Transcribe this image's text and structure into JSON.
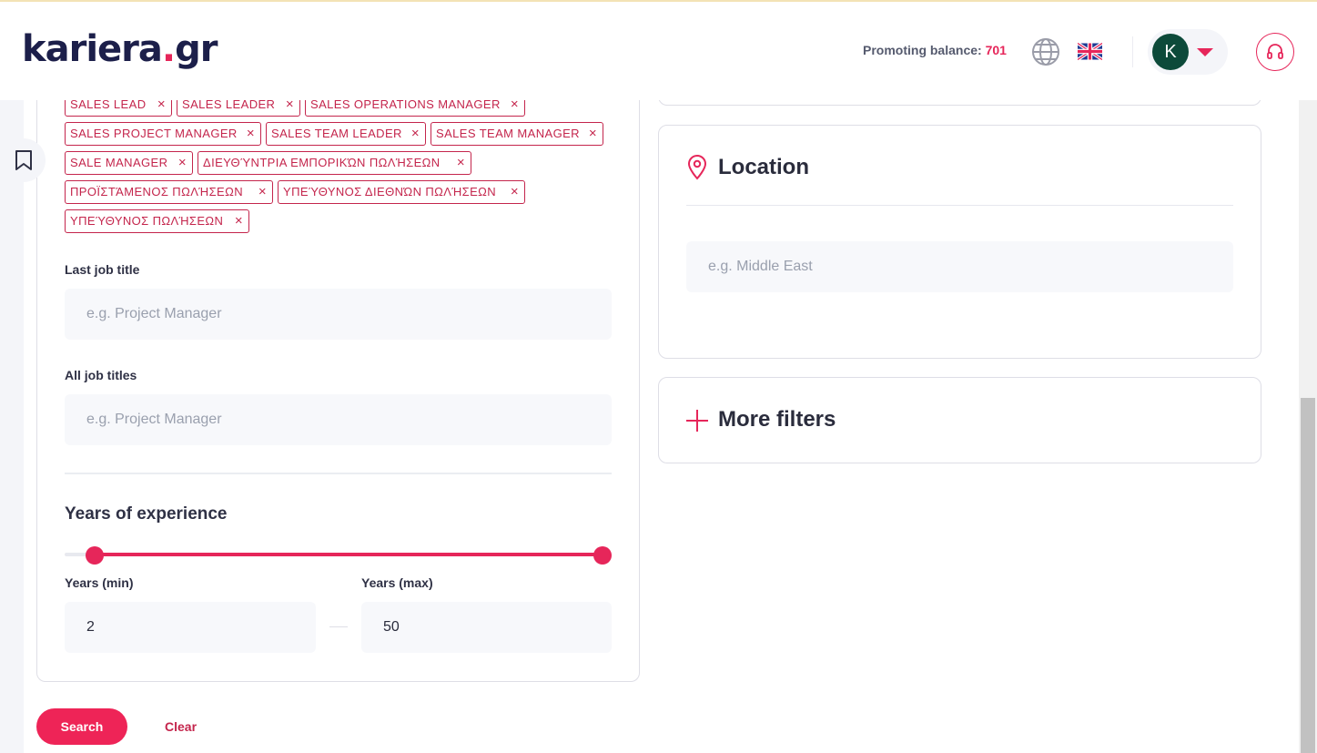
{
  "header": {
    "logo_main": "kariera",
    "logo_dot": ".",
    "logo_tld": "gr",
    "balance_label": "Promoting balance: ",
    "balance_value": "701",
    "avatar_initial": "K",
    "language_icon": "globe-icon",
    "flag_icon": "uk-flag-icon",
    "support_icon": "headset-icon"
  },
  "tags": [
    "SALES LEAD",
    "SALES LEADER",
    "SALES OPERATIONS MANAGER",
    "SALES PROJECT MANAGER",
    "SALES TEAM LEADER",
    "SALES TEAM MANAGER",
    "SALE MANAGER",
    "ΔΙΕΥΘΎΝΤΡΙΑ ΕΜΠΟΡΙΚΏΝ ΠΩΛΉΣΕΩΝ",
    "ΠΡΟΪΣΤΆΜΕΝΟΣ ΠΩΛΉΣΕΩΝ",
    "ΥΠΕΎΘΥΝΟΣ ΔΙΕΘΝΏΝ ΠΩΛΉΣΕΩΝ",
    "ΥΠΕΎΘΥΝΟΣ ΠΩΛΉΣΕΩΝ"
  ],
  "tag_remove_glyph": "×",
  "filters": {
    "last_job_title_label": "Last job title",
    "last_job_title_placeholder": "e.g. Project Manager",
    "all_job_titles_label": "All job titles",
    "all_job_titles_placeholder": "e.g. Project Manager",
    "experience_title": "Years of experience",
    "years_min_label": "Years (min)",
    "years_max_label": "Years (max)",
    "years_min_value": "2",
    "years_max_value": "50",
    "slider_min_fraction": 0.04,
    "slider_max_fraction": 1.0
  },
  "location": {
    "title": "Location",
    "icon": "map-pin-icon",
    "placeholder": "e.g. Middle East"
  },
  "more_filters": {
    "title": "More filters",
    "icon": "plus-icon"
  },
  "actions": {
    "search_label": "Search",
    "clear_label": "Clear"
  },
  "colors": {
    "accent": "#e6265a",
    "brand_navy": "#1c1f4a",
    "avatar_bg": "#0d4a3a"
  }
}
